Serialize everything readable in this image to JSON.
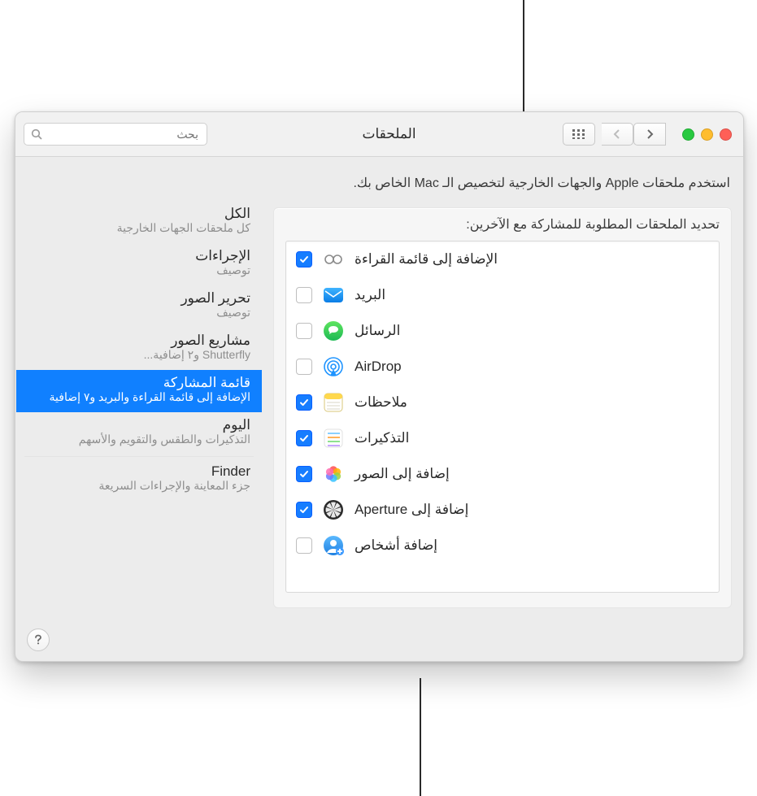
{
  "window": {
    "title": "الملحقات",
    "search_placeholder": "بحث",
    "description": "استخدم ملحقات Apple والجهات الخارجية لتخصيص الـ Mac الخاص بك."
  },
  "sidebar": {
    "items": [
      {
        "title": "الكل",
        "sub": "كل ملحقات الجهات الخارجية"
      },
      {
        "title": "الإجراءات",
        "sub": "توصيف"
      },
      {
        "title": "تحرير الصور",
        "sub": "توصيف"
      },
      {
        "title": "مشاريع الصور",
        "sub": "Shutterfly  و٢ إضافية..."
      },
      {
        "title": "قائمة المشاركة",
        "sub": "الإضافة إلى قائمة القراءة والبريد  و٧ إضافية",
        "selected": true
      },
      {
        "title": "اليوم",
        "sub": "التذكيرات والطقس والتقويم والأسهم"
      },
      {
        "title": "Finder",
        "sub": "جزء المعاينة والإجراءات السريعة"
      }
    ]
  },
  "panel": {
    "heading": "تحديد الملحقات المطلوبة للمشاركة مع الآخرين:"
  },
  "items": [
    {
      "label": "الإضافة إلى قائمة القراءة",
      "icon": "glasses",
      "checked": true
    },
    {
      "label": "البريد",
      "icon": "mail",
      "checked": false
    },
    {
      "label": "الرسائل",
      "icon": "messages",
      "checked": false
    },
    {
      "label": "AirDrop",
      "icon": "airdrop",
      "checked": false
    },
    {
      "label": "ملاحظات",
      "icon": "notes",
      "checked": true
    },
    {
      "label": "التذكيرات",
      "icon": "reminders",
      "checked": true
    },
    {
      "label": "إضافة إلى الصور",
      "icon": "photos",
      "checked": true
    },
    {
      "label": "إضافة إلى Aperture",
      "icon": "aperture",
      "checked": true
    },
    {
      "label": "إضافة أشخاص",
      "icon": "people-add",
      "checked": false
    }
  ]
}
